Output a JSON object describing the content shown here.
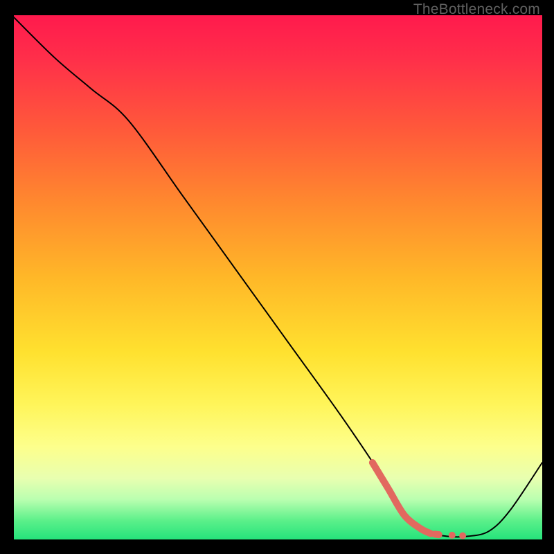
{
  "watermark": "TheBottleneck.com",
  "chart_data": {
    "type": "line",
    "title": "",
    "xlabel": "",
    "ylabel": "",
    "xlim": [
      0,
      100
    ],
    "ylim": [
      0,
      100
    ],
    "grid": false,
    "legend": false,
    "series": [
      {
        "name": "bottleneck-curve",
        "color": "#000000",
        "stroke_width": 2,
        "x": [
          0,
          8,
          15,
          22,
          32,
          42,
          52,
          62,
          70,
          74,
          78,
          82,
          86,
          90,
          94,
          100
        ],
        "y": [
          100,
          92,
          86,
          80,
          66,
          52,
          38,
          24,
          12,
          5,
          2,
          1,
          1,
          2,
          6,
          15
        ]
      },
      {
        "name": "highlight-segment",
        "color": "#e2695f",
        "stroke_width": 10,
        "style": "segmented",
        "x": [
          68,
          71,
          74,
          77,
          79,
          80.5,
          83,
          85
        ],
        "y": [
          15,
          10,
          5,
          2.5,
          1.5,
          1.3,
          1.2,
          1.1
        ]
      }
    ],
    "background_gradient": {
      "direction": "vertical",
      "stops": [
        {
          "pos": 0.0,
          "color": "#ff1a4d"
        },
        {
          "pos": 0.36,
          "color": "#ff8a2e"
        },
        {
          "pos": 0.64,
          "color": "#ffe12f"
        },
        {
          "pos": 0.88,
          "color": "#e8ffb0"
        },
        {
          "pos": 1.0,
          "color": "#1fe27a"
        }
      ]
    }
  }
}
